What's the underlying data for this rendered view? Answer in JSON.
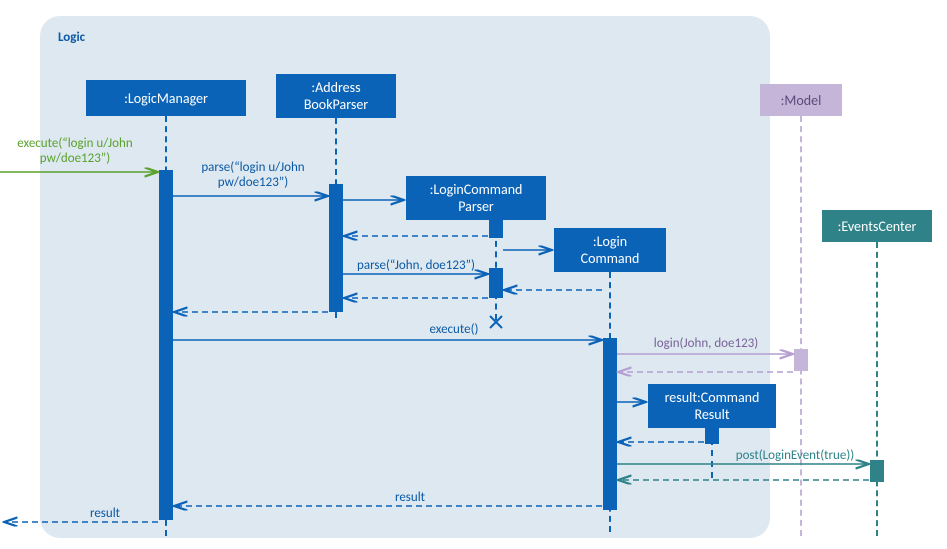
{
  "chart_data": {
    "type": "sequence-diagram",
    "frame": {
      "label": "Logic"
    },
    "participants": [
      {
        "id": "LogicManager",
        "label": ":LogicManager",
        "in_frame": true
      },
      {
        "id": "AddressBookParser",
        "label": ":Address\nBookParser",
        "in_frame": true
      },
      {
        "id": "LoginCommandParser",
        "label": ":LoginCommand\nParser",
        "in_frame": true,
        "created_by_message": true
      },
      {
        "id": "LoginCommand",
        "label": ":Login\nCommand",
        "in_frame": true,
        "created_by_message": true
      },
      {
        "id": "CommandResult",
        "label": "result:Command\nResult",
        "in_frame": true,
        "created_by_message": true
      },
      {
        "id": "Model",
        "label": ":Model",
        "in_frame": false
      },
      {
        "id": "EventsCenter",
        "label": ":EventsCenter",
        "in_frame": false
      }
    ],
    "messages": [
      {
        "from": "external",
        "to": "LogicManager",
        "label": "execute(“login u/John pw/doe123”)",
        "style": "solid"
      },
      {
        "from": "LogicManager",
        "to": "AddressBookParser",
        "label": "parse(“login u/John pw/doe123”)",
        "style": "solid"
      },
      {
        "from": "AddressBookParser",
        "to": "LoginCommandParser",
        "label": "",
        "style": "solid",
        "creates": true
      },
      {
        "from": "LoginCommandParser",
        "to": "AddressBookParser",
        "label": "",
        "style": "dashed"
      },
      {
        "from": "AddressBookParser",
        "to": "LoginCommandParser",
        "label": "parse(“John, doe123”)",
        "style": "solid"
      },
      {
        "from": "LoginCommandParser",
        "to": "LoginCommand",
        "label": "",
        "style": "solid",
        "creates": true
      },
      {
        "from": "LoginCommand",
        "to": "LoginCommandParser",
        "label": "",
        "style": "dashed"
      },
      {
        "from": "LoginCommandParser",
        "to": "AddressBookParser",
        "label": "",
        "style": "dashed"
      },
      {
        "from": "AddressBookParser",
        "to": "LogicManager",
        "label": "",
        "style": "dashed"
      },
      {
        "from": "LoginCommandParser",
        "destroy": true
      },
      {
        "from": "LogicManager",
        "to": "LoginCommand",
        "label": "execute()",
        "style": "solid"
      },
      {
        "from": "LoginCommand",
        "to": "Model",
        "label": "login(John, doe123)",
        "style": "solid"
      },
      {
        "from": "Model",
        "to": "LoginCommand",
        "label": "",
        "style": "dashed"
      },
      {
        "from": "LoginCommand",
        "to": "CommandResult",
        "label": "",
        "style": "solid",
        "creates": true
      },
      {
        "from": "CommandResult",
        "to": "LoginCommand",
        "label": "",
        "style": "dashed"
      },
      {
        "from": "LoginCommand",
        "to": "EventsCenter",
        "label": "post(LoginEvent(true))",
        "style": "solid"
      },
      {
        "from": "EventsCenter",
        "to": "LoginCommand",
        "label": "",
        "style": "dashed"
      },
      {
        "from": "LoginCommand",
        "to": "LogicManager",
        "label": "result",
        "style": "dashed"
      },
      {
        "from": "LogicManager",
        "to": "external",
        "label": "result",
        "style": "dashed"
      }
    ]
  },
  "labels": {
    "frame": "Logic",
    "p_logicmanager": ":LogicManager",
    "p_addressbookparser": ":Address\nBookParser",
    "p_logincommandparser": ":LoginCommand\nParser",
    "p_logincommand": ":Login\nCommand",
    "p_commandresult": "result:Command\nResult",
    "p_model": ":Model",
    "p_eventscenter": ":EventsCenter",
    "m_execute_in": "execute(“login u/John\npw/doe123”)",
    "m_parse1": "parse(“login u/John\npw/doe123”)",
    "m_parse2": "parse(“John, doe123”)",
    "m_execute": "execute()",
    "m_login": "login(John, doe123)",
    "m_post": "post(LoginEvent(true))",
    "m_result1": "result",
    "m_result2": "result"
  }
}
